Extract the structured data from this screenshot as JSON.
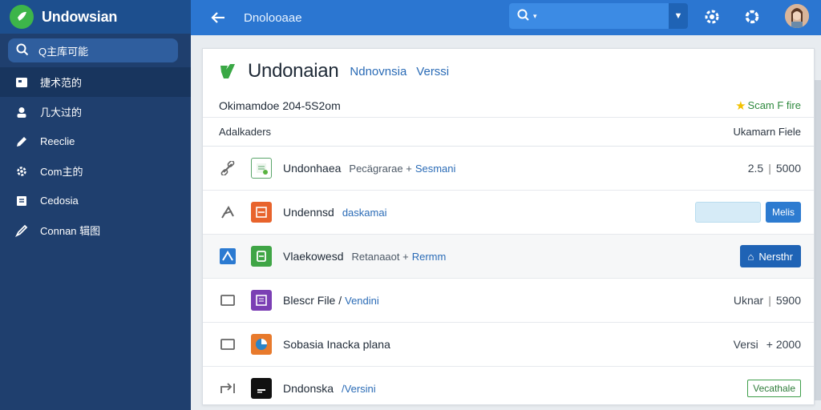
{
  "app": {
    "brand": "Undowsian",
    "top_title": "Dnolooaae",
    "search_placeholder": ""
  },
  "sidebar": {
    "search_label": "Q主库可能",
    "items": [
      {
        "label": "捷术范的",
        "icon": "folder-icon",
        "active": true
      },
      {
        "label": "几大过的",
        "icon": "user-icon"
      },
      {
        "label": "Reeclie",
        "icon": "edit-icon"
      },
      {
        "label": "Com主的",
        "icon": "settings-gear-icon"
      },
      {
        "label": "Cedosia",
        "icon": "document-icon"
      },
      {
        "label": "Connan 辑图",
        "icon": "pen-icon"
      }
    ]
  },
  "panel": {
    "title": "Undonaian",
    "sub1": "Ndnovnsia",
    "sub2": "Verssi",
    "info_left": "Okimamdoe 204-5S2om",
    "info_right": "Scam F fire",
    "col_left": "Adalkaders",
    "col_right": "Ukamarn Fiele",
    "rows": [
      {
        "name": "Undonhaea",
        "meta": "Pecägrarae +",
        "link": "Sesmani",
        "right_a": "2.5",
        "right_b": "5000"
      },
      {
        "name": "Undennsd",
        "meta": "",
        "link": "daskamai",
        "btn": "Melis"
      },
      {
        "name": "Vlaekowesd",
        "meta": "Retanaaot +",
        "link": "Rermm",
        "btn": "Nersthr"
      },
      {
        "name": "Blescr File /",
        "meta": "",
        "link": "Vendini",
        "right_a": "Uknar",
        "right_b": "5900"
      },
      {
        "name": "Sobasia Inacka plana",
        "meta": "",
        "link": "",
        "right_a": "Versi",
        "right_b": "+ 2000"
      },
      {
        "name": "Dndonska",
        "meta": "",
        "link": "/Versini",
        "btn": "Vecathale"
      }
    ]
  }
}
